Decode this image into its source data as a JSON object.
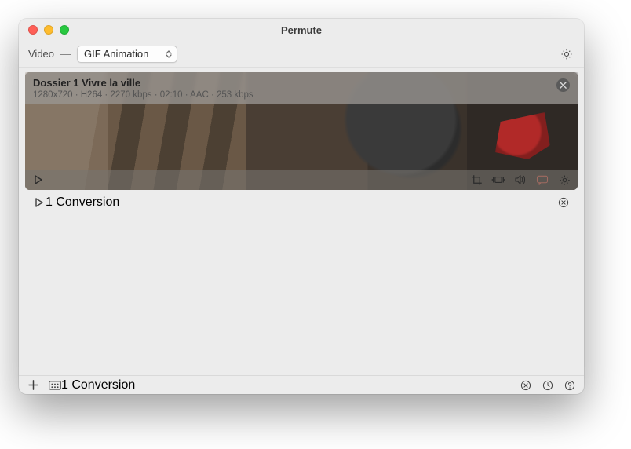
{
  "window": {
    "title": "Permute"
  },
  "formatbar": {
    "type_label": "Video",
    "dash": "—",
    "preset_selected": "GIF Animation"
  },
  "item": {
    "title": "Dossier 1 Vivre la ville",
    "meta": "1280x720 · H264 · 2270 kbps · 02:10 · AAC · 253 kbps"
  },
  "status_mid": "1 Conversion",
  "footer_mid": "1 Conversion"
}
